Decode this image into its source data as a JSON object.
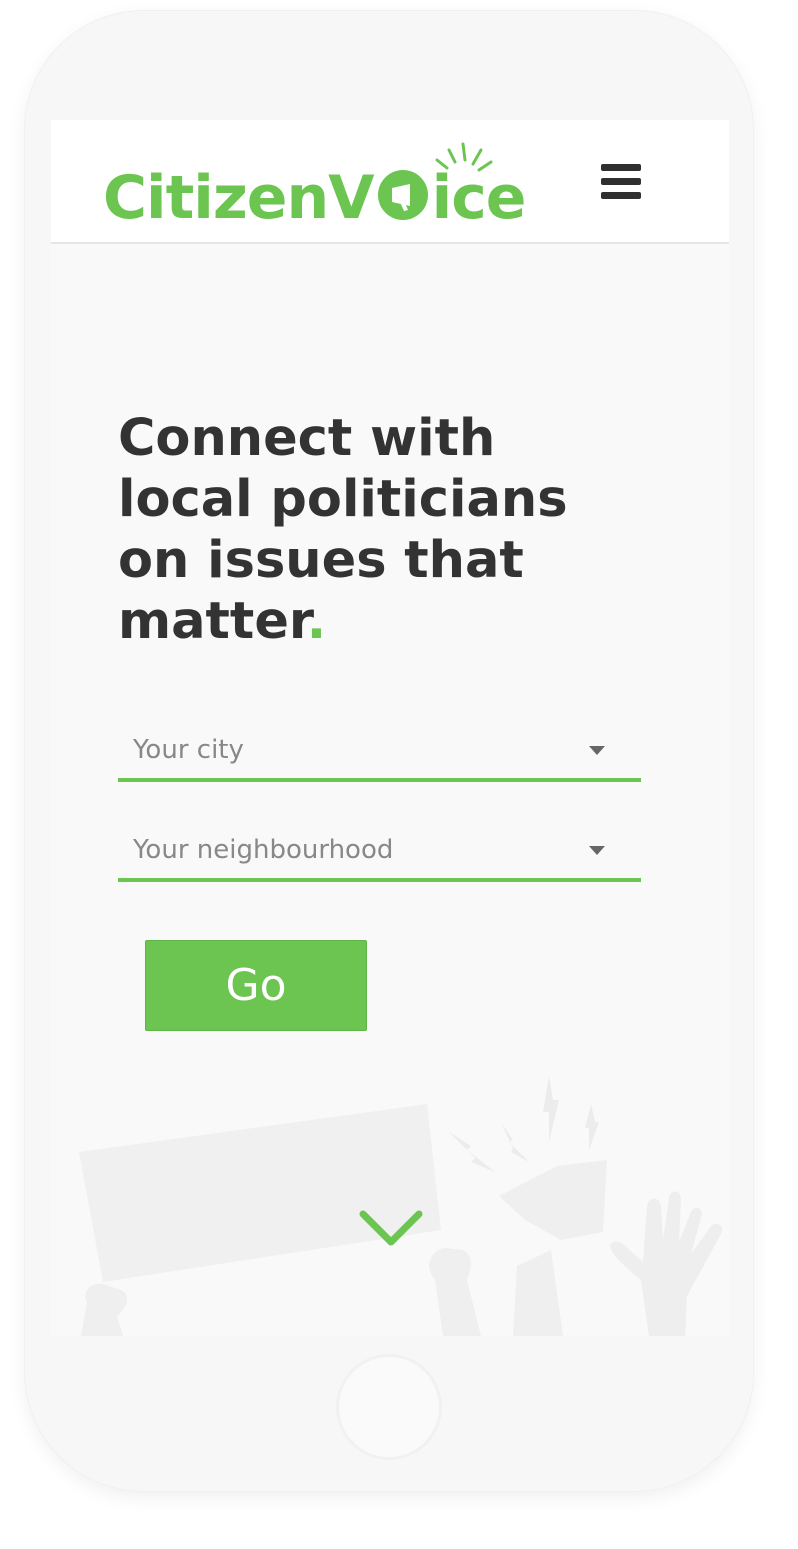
{
  "header": {
    "logo_text_a": "CitizenV",
    "logo_text_b": "ice",
    "menu_icon": "hamburger-menu-icon"
  },
  "hero": {
    "title": "Connect with local politicians on issues that matter",
    "title_dot": "."
  },
  "form": {
    "city_placeholder": "Your city",
    "neighbourhood_placeholder": "Your neighbourhood",
    "go_label": "Go"
  },
  "icons": {
    "dropdown": "caret-down-icon",
    "scroll": "chevron-down-icon"
  },
  "colors": {
    "brand": "#6cc551",
    "text": "#333333",
    "placeholder": "#888888",
    "screen_bg": "#f9f9f9",
    "illustration": "#efefef"
  }
}
